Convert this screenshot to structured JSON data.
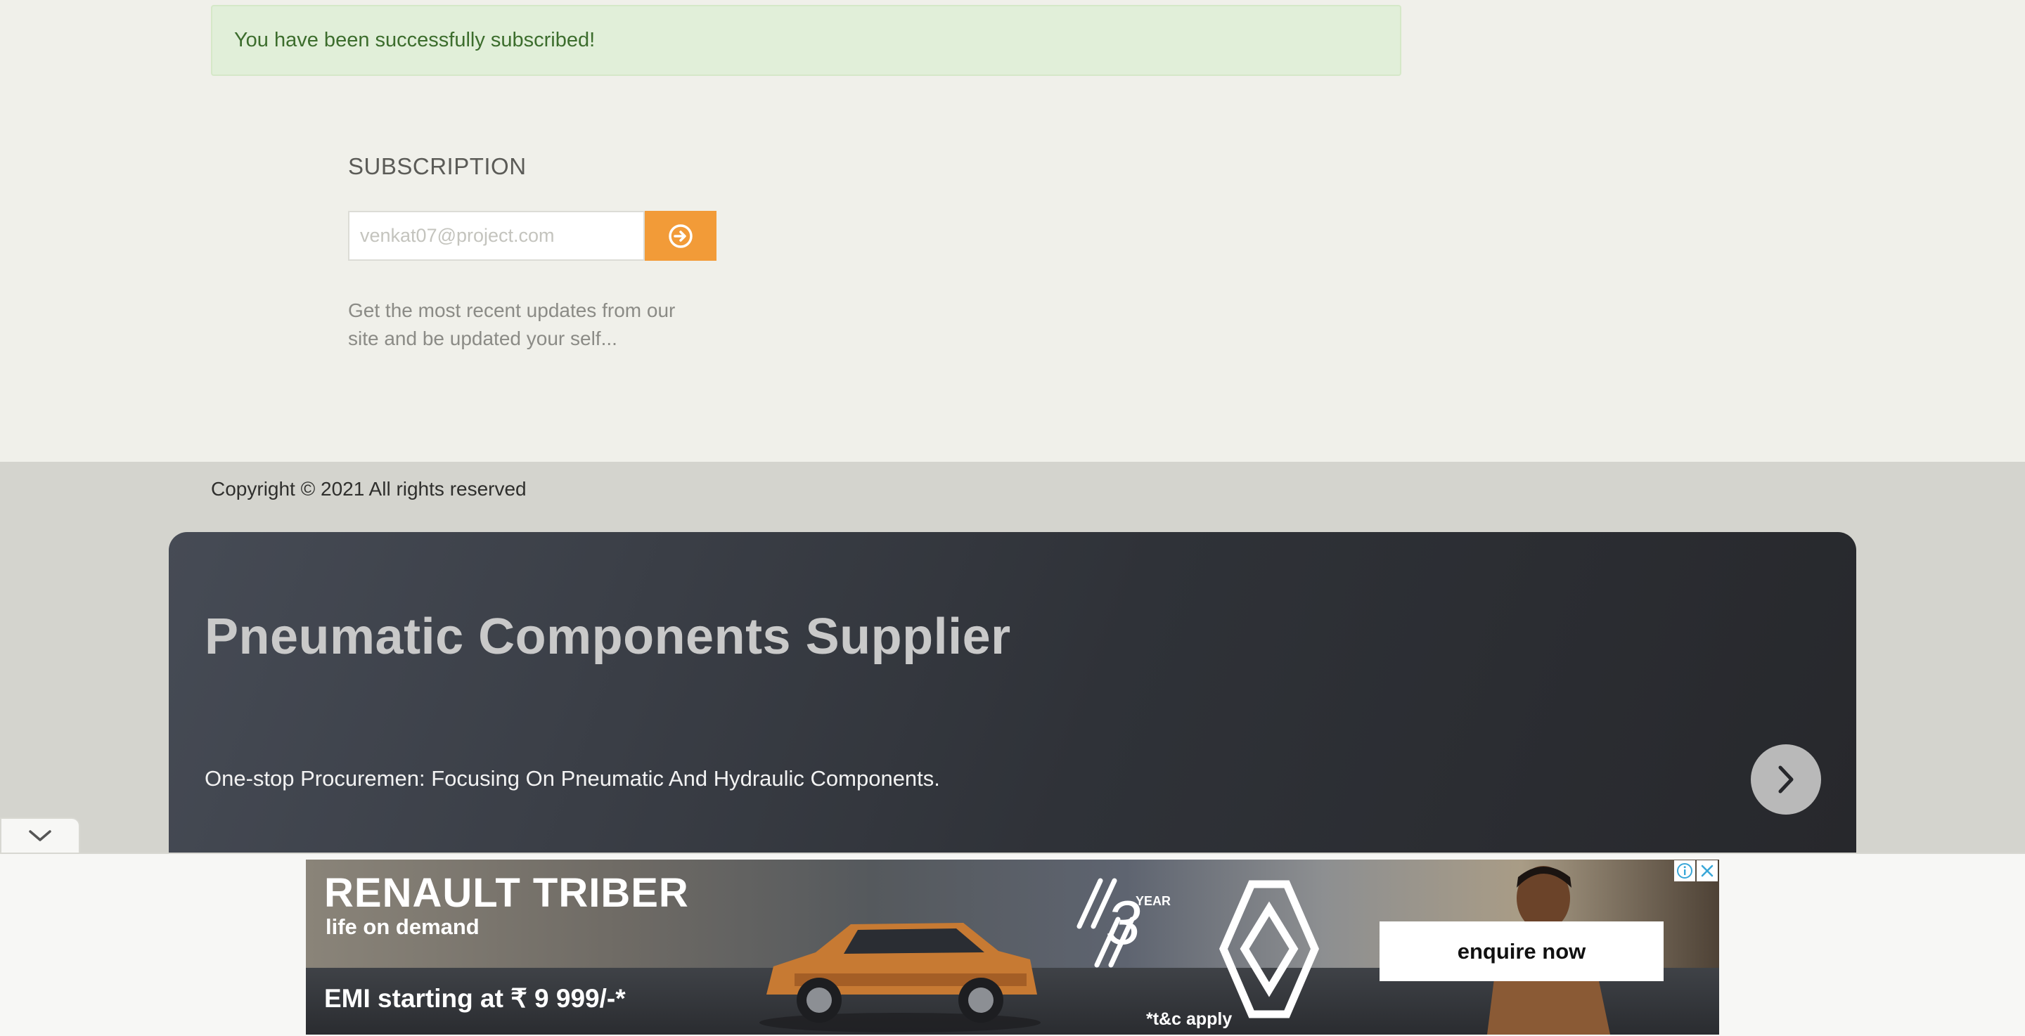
{
  "alert": {
    "message": "You have been successfully subscribed!"
  },
  "subscription": {
    "title": "SUBSCRIPTION",
    "email_placeholder": "venkat07@project.com",
    "description": "Get the most recent updates from our site and be updated your self..."
  },
  "footer": {
    "copyright": "Copyright © 2021 All rights reserved"
  },
  "banner": {
    "title": "Pneumatic Components Supplier",
    "subtitle": "One-stop Procuremen: Focusing On Pneumatic And Hydraulic Components."
  },
  "ad": {
    "brand": "RENAULT TRIBER",
    "tagline": "life on demand",
    "emi_text": "EMI starting at ₹ 9 999/-*",
    "warranty_number": "3",
    "warranty_label": "YEAR",
    "terms": "*t&c apply",
    "cta_label": "enquire now"
  },
  "icons": {
    "subscribe": "arrow-circle-right-icon",
    "banner_next": "chevron-right-icon",
    "ad_toggle": "chevron-down-icon",
    "ad_info": "info-icon",
    "ad_close": "close-icon"
  },
  "colors": {
    "accent": "#f29b38",
    "success_bg": "#e1efd9",
    "success_text": "#3c6d2d",
    "banner_bg": "#2f3238"
  }
}
